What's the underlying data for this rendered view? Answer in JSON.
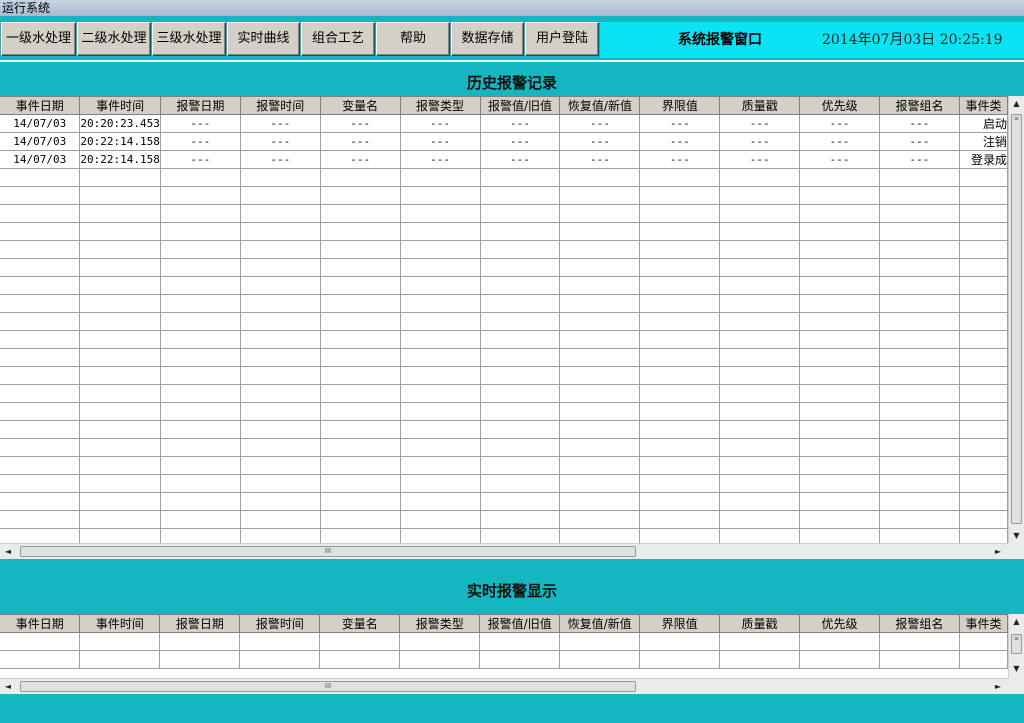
{
  "window": {
    "title": "运行系统"
  },
  "toolbar": {
    "buttons": [
      "一级水处理",
      "二级水处理",
      "三级水处理",
      "实时曲线",
      "组合工艺",
      "帮助",
      "数据存储",
      "用户登陆"
    ]
  },
  "header": {
    "title": "系统报警窗口",
    "datetime": "2014年07月03日 20:25:19"
  },
  "history": {
    "title": "历史报警记录",
    "columns": [
      "事件日期",
      "事件时间",
      "报警日期",
      "报警时间",
      "变量名",
      "报警类型",
      "报警值/旧值",
      "恢复值/新值",
      "界限值",
      "质量戳",
      "优先级",
      "报警组名",
      "事件类"
    ],
    "rows": [
      [
        "14/07/03",
        "20:20:23.453",
        "---",
        "---",
        "---",
        "---",
        "---",
        "---",
        "---",
        "---",
        "---",
        "---",
        "启动"
      ],
      [
        "14/07/03",
        "20:22:14.158",
        "---",
        "---",
        "---",
        "---",
        "---",
        "---",
        "---",
        "---",
        "---",
        "---",
        "注销"
      ],
      [
        "14/07/03",
        "20:22:14.158",
        "---",
        "---",
        "---",
        "---",
        "---",
        "---",
        "---",
        "---",
        "---",
        "---",
        "登录成"
      ]
    ]
  },
  "realtime": {
    "title": "实时报警显示",
    "columns": [
      "事件日期",
      "事件时间",
      "报警日期",
      "报警时间",
      "变量名",
      "报警类型",
      "报警值/旧值",
      "恢复值/新值",
      "界限值",
      "质量戳",
      "优先级",
      "报警组名",
      "事件类"
    ]
  },
  "scroll": {
    "up": "▲",
    "down": "▼",
    "left": "◄",
    "right": "►",
    "grip": "III",
    "vgrip": "≡"
  },
  "colors": {
    "background": "#14b6c0",
    "header_panel": "#08e4f4",
    "button_face": "#d4d0c8"
  }
}
